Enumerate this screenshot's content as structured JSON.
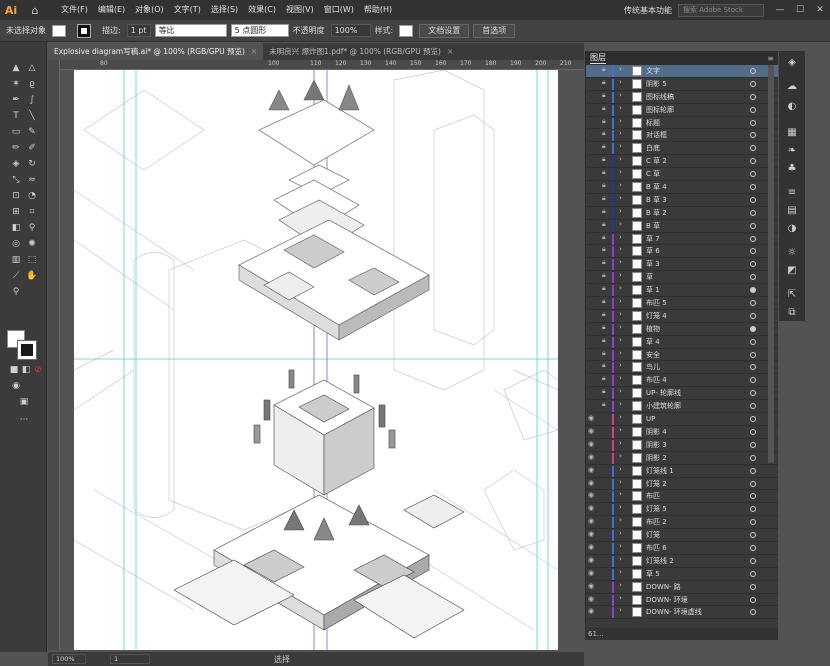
{
  "app": {
    "logo": "Ai",
    "workspace": "传统基本功能",
    "search_placeholder": "搜索 Adobe Stock"
  },
  "menu": [
    "文件(F)",
    "编辑(E)",
    "对象(O)",
    "文字(T)",
    "选择(S)",
    "效果(C)",
    "视图(V)",
    "窗口(W)",
    "帮助(H)"
  ],
  "control": {
    "selection": "未选择对象",
    "stroke_label": "描边:",
    "stroke_value": "1 pt",
    "uniform": "等比",
    "brush": "5 点圆形",
    "opacity_label": "不透明度",
    "opacity": "100%",
    "style_label": "样式:",
    "doc_setup": "文档设置",
    "prefs": "首选项"
  },
  "tabs": [
    {
      "title": "Explosive diagram写稿.ai* @ 100% (RGB/GPU 预览)",
      "active": true
    },
    {
      "title": "未明良兴 爆炸图1.pdf* @ 100% (RGB/GPU 预览)",
      "active": false
    }
  ],
  "ruler_ticks": [
    "80",
    "100",
    "110",
    "120",
    "130",
    "140",
    "150",
    "160",
    "170",
    "180",
    "190",
    "200",
    "210"
  ],
  "status": {
    "zoom": "100%",
    "artboard": "1",
    "tool": "选择"
  },
  "layers_panel": {
    "title": "图层",
    "footer": "61..."
  },
  "layers": [
    {
      "name": "文字",
      "color": "#3f6fd7",
      "selected": true
    },
    {
      "name": "阴影 5",
      "color": "#3f6fd7"
    },
    {
      "name": "图标线稿",
      "color": "#3f6fd7"
    },
    {
      "name": "图标轮廓",
      "color": "#3f6fd7"
    },
    {
      "name": "标题",
      "color": "#3f6fd7"
    },
    {
      "name": "对话框",
      "color": "#3f6fd7"
    },
    {
      "name": "白底",
      "color": "#3f6fd7"
    },
    {
      "name": "C 草 2",
      "color": "#1a3aa0"
    },
    {
      "name": "C 草",
      "color": "#1a3aa0"
    },
    {
      "name": "B 草 4",
      "color": "#1a3aa0"
    },
    {
      "name": "B 草 3",
      "color": "#1a3aa0"
    },
    {
      "name": "B 草 2",
      "color": "#1a3aa0"
    },
    {
      "name": "B 草",
      "color": "#1a3aa0"
    },
    {
      "name": "草 7",
      "color": "#8a3fd7"
    },
    {
      "name": "草 6",
      "color": "#8a3fd7"
    },
    {
      "name": "草 3",
      "color": "#8a3fd7"
    },
    {
      "name": "草",
      "color": "#8a3fd7"
    },
    {
      "name": "草 1",
      "color": "#8a3fd7",
      "filled": true
    },
    {
      "name": "布匹 5",
      "color": "#8a3fd7"
    },
    {
      "name": "灯笼 4",
      "color": "#8a3fd7"
    },
    {
      "name": "植物",
      "color": "#8a3fd7",
      "filled": true
    },
    {
      "name": "草 4",
      "color": "#8a3fd7"
    },
    {
      "name": "安全",
      "color": "#8a3fd7"
    },
    {
      "name": "鸟儿",
      "color": "#8a3fd7"
    },
    {
      "name": "布匹 4",
      "color": "#8a3fd7"
    },
    {
      "name": "UP- 轮廓线",
      "color": "#8a3fd7"
    },
    {
      "name": "小建筑轮廓",
      "color": "#8a3fd7"
    },
    {
      "name": "UP",
      "color": "#d73f8a"
    },
    {
      "name": "阴影 4",
      "color": "#d73f8a"
    },
    {
      "name": "阴影 3",
      "color": "#d73f8a"
    },
    {
      "name": "阴影 2",
      "color": "#d73f8a"
    },
    {
      "name": "灯笼线 1",
      "color": "#3f6fd7"
    },
    {
      "name": "灯笼 2",
      "color": "#3f6fd7"
    },
    {
      "name": "布匹",
      "color": "#3f6fd7"
    },
    {
      "name": "灯笼 5",
      "color": "#3f6fd7"
    },
    {
      "name": "布匹 2",
      "color": "#3f6fd7"
    },
    {
      "name": "灯笼",
      "color": "#3f6fd7"
    },
    {
      "name": "布匹 6",
      "color": "#3f6fd7"
    },
    {
      "name": "灯笼线 2",
      "color": "#3f6fd7"
    },
    {
      "name": "草 5",
      "color": "#3f6fd7"
    },
    {
      "name": "DOWN- 路",
      "color": "#8a3fd7"
    },
    {
      "name": "DOWN- 环境",
      "color": "#8a3fd7"
    },
    {
      "name": "DOWN- 环境虚线",
      "color": "#8a3fd7"
    }
  ]
}
